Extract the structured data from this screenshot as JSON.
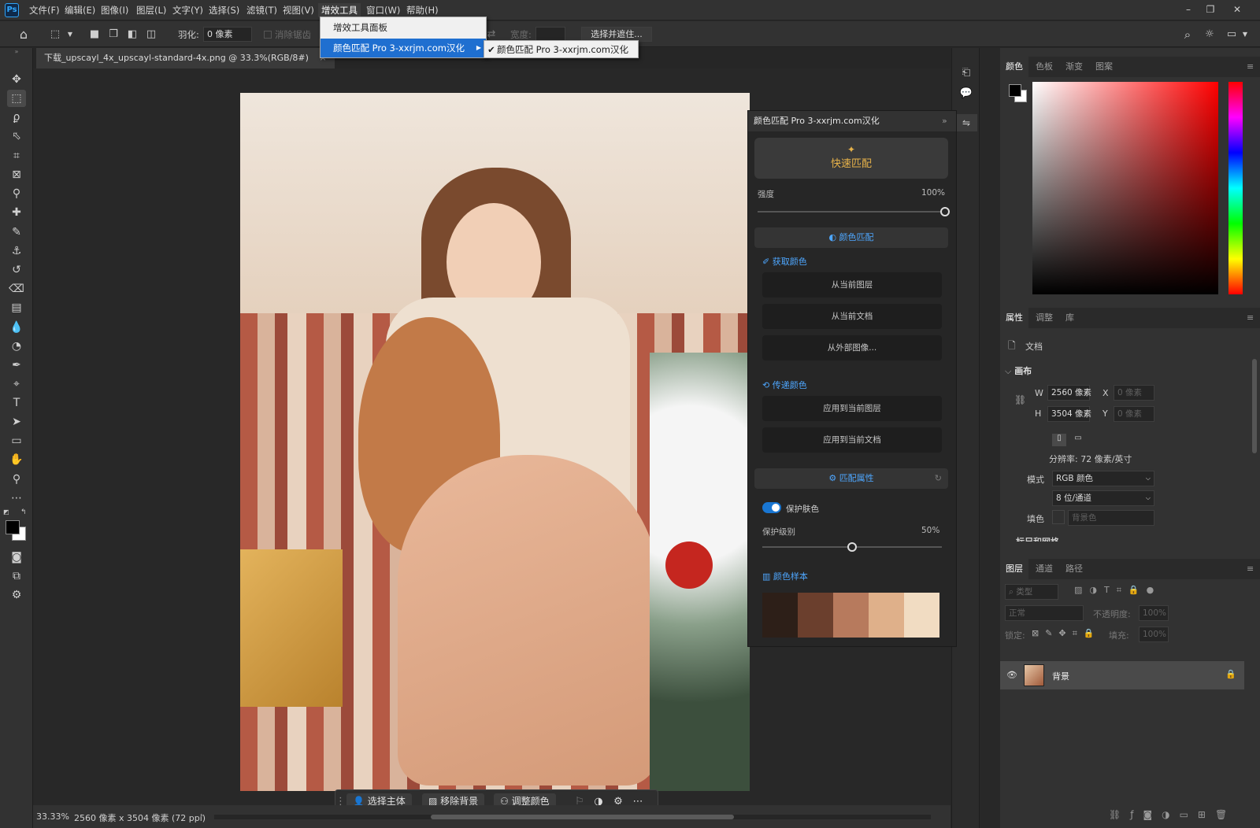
{
  "app": {
    "logo": "Ps"
  },
  "menubar": {
    "items": [
      "文件(F)",
      "编辑(E)",
      "图像(I)",
      "图层(L)",
      "文字(Y)",
      "选择(S)",
      "滤镜(T)",
      "视图(V)",
      "增效工具",
      "窗口(W)",
      "帮助(H)"
    ],
    "window_controls": [
      "–",
      "❐",
      "✕"
    ]
  },
  "options": {
    "feather_label": "羽化:",
    "feather_value": "0 像素",
    "antialias_label": "消除锯齿",
    "width_label": "宽度:",
    "select_mask_button": "选择并遮住..."
  },
  "plugins_menu": {
    "items": [
      "增效工具面板",
      "颜色匹配 Pro 3-xxrjm.com汉化"
    ],
    "submenu_item": "颜色匹配 Pro 3-xxrjm.com汉化",
    "submenu_check": "✔"
  },
  "document": {
    "tab_title": "下载_upscayl_4x_upscayl-standard-4x.png @ 33.3%(RGB/8#)",
    "tab_close": "×"
  },
  "statusbar": {
    "zoom": "33.33%",
    "info": "2560 像素 x 3504 像素 (72 ppi)"
  },
  "contextbar": {
    "select_subject": "选择主体",
    "remove_bg": "移除背景",
    "adjust_color": "调整颜色",
    "more": "⋯"
  },
  "plugin_panel": {
    "title": "颜色匹配 Pro 3-xxrjm.com汉化",
    "quick_match": "快速匹配",
    "strength_label": "强度",
    "strength_value": "100%",
    "strength": 1.0,
    "color_match_section": "颜色匹配",
    "get_color_head": "获取颜色",
    "btn_from_layer": "从当前图层",
    "btn_from_doc": "从当前文档",
    "btn_from_external": "从外部图像...",
    "transfer_head": "传递颜色",
    "btn_apply_layer": "应用到当前图层",
    "btn_apply_doc": "应用到当前文档",
    "match_props_section": "匹配属性",
    "protect_skin": "保护肤色",
    "protect_level_label": "保护级别",
    "protect_level_value": "50%",
    "protect_level": 0.5,
    "samples_head": "颜色样本",
    "swatches": [
      "#2d1f18",
      "#6b3f2d",
      "#b77a5d",
      "#dfb08a",
      "#f1dcc2"
    ]
  },
  "color_panel": {
    "tabs": [
      "颜色",
      "色板",
      "渐变",
      "图案"
    ],
    "fg_color": "#000000",
    "bg_color": "#ffffff"
  },
  "properties_panel": {
    "tabs": [
      "属性",
      "调整",
      "库"
    ],
    "doc_label": "文档",
    "canvas_head": "画布",
    "w_label": "W",
    "w_value": "2560 像素",
    "h_label": "H",
    "h_value": "3504 像素",
    "x_label": "X",
    "x_placeholder": "0 像素",
    "y_label": "Y",
    "y_placeholder": "0 像素",
    "resolution": "分辨率: 72 像素/英寸",
    "mode_label": "模式",
    "mode_value": "RGB 颜色",
    "depth_value": "8 位/通道",
    "fill_label": "填色",
    "fill_value": "背景色",
    "rulers_head": "标尺和网格"
  },
  "layers_panel": {
    "tabs": [
      "图层",
      "通道",
      "路径"
    ],
    "filter_placeholder": "类型",
    "blend_mode": "正常",
    "opacity_label": "不透明度:",
    "opacity_value": "100%",
    "lock_label": "锁定:",
    "fill_label": "填充:",
    "fill_value": "100%",
    "layer_name": "背景"
  }
}
